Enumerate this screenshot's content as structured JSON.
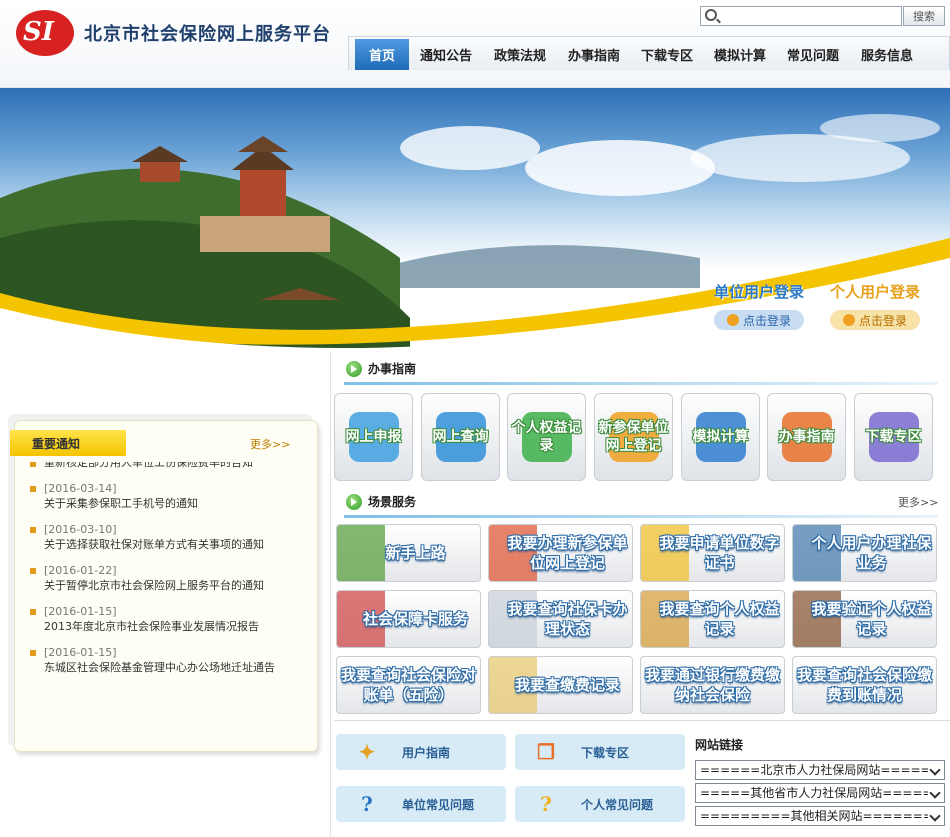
{
  "header": {
    "logo_text": "SI",
    "site_title": "北京市社会保险网上服务平台",
    "search_placeholder": "",
    "search_button": "搜索"
  },
  "nav": [
    {
      "label": "首页",
      "active": true
    },
    {
      "label": "通知公告"
    },
    {
      "label": "政策法规"
    },
    {
      "label": "办事指南"
    },
    {
      "label": "下载专区"
    },
    {
      "label": "模拟计算"
    },
    {
      "label": "常见问题"
    },
    {
      "label": "服务信息"
    }
  ],
  "login": {
    "unit_title": "单位用户登录",
    "unit_button": "点击登录",
    "person_title": "个人用户登录",
    "person_button": "点击登录"
  },
  "notices": {
    "tab": "重要通知",
    "more": "更多>>",
    "items": [
      {
        "date": "",
        "title": "重新核定部分用人单位工伤保险费率的告知"
      },
      {
        "date": "[2016-03-14]",
        "title": "关于采集参保职工手机号的通知"
      },
      {
        "date": "[2016-03-10]",
        "title": "关于选择获取社保对账单方式有关事项的通知"
      },
      {
        "date": "[2016-01-22]",
        "title": "关于暂停北京市社会保险网上服务平台的通知"
      },
      {
        "date": "[2016-01-15]",
        "title": "2013年度北京市社会保险事业发展情况报告"
      },
      {
        "date": "[2016-01-15]",
        "title": "东城区社会保险基金管理中心办公场地迁址通告"
      }
    ]
  },
  "guide": {
    "title": "办事指南",
    "tiles": [
      "网上申报",
      "网上查询",
      "个人权益记录",
      "新参保单位网上登记",
      "模拟计算",
      "办事指南",
      "下载专区"
    ],
    "colors": [
      "#3fa0e0",
      "#2f8fd8",
      "#3cb04a",
      "#f0a020",
      "#2f7ed0",
      "#e8702a",
      "#7a6ad0"
    ]
  },
  "scene": {
    "title": "场景服务",
    "more": "更多>>",
    "tiles": [
      "新手上路",
      "我要办理新参保单位网上登记",
      "我要申请单位数字证书",
      "个人用户办理社保业务",
      "社会保障卡服务",
      "我要查询社保卡办理状态",
      "我要查询个人权益记录",
      "我要验证个人权益记录",
      "我要查询社会保险对账单（五险）",
      "我要查缴费记录",
      "我要通过银行缴费缴纳社会保险",
      "我要查询社会保险缴费到账情况"
    ]
  },
  "quick": [
    {
      "label": "用户指南",
      "icon": "✦"
    },
    {
      "label": "下载专区",
      "icon": "❒"
    },
    {
      "label": "单位常见问题",
      "icon": "?"
    },
    {
      "label": "个人常见问题",
      "icon": "?"
    }
  ],
  "links": {
    "title": "网站链接",
    "selects": [
      "======北京市人力社保局网站=======",
      "=====其他省市人力社保局网站======",
      "=========其他相关网站==========="
    ]
  }
}
